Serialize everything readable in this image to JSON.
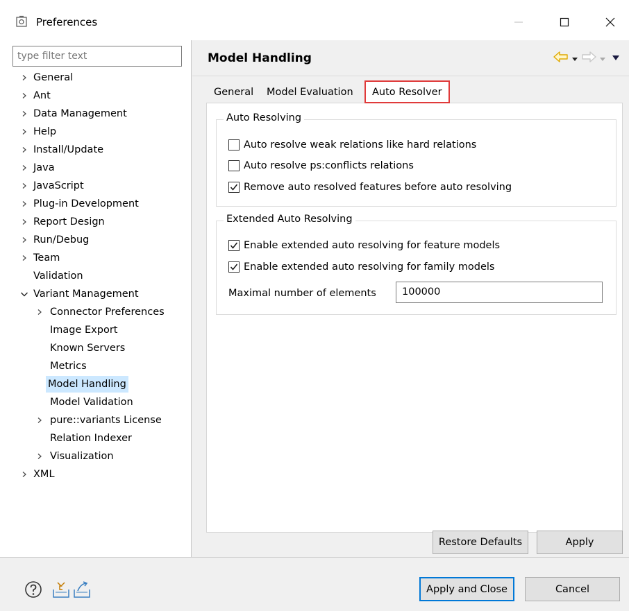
{
  "window": {
    "title": "Preferences",
    "icon": "preferences-icon"
  },
  "filter": {
    "placeholder": "type filter text"
  },
  "tree": [
    {
      "label": "General",
      "expander": "collapsed"
    },
    {
      "label": "Ant",
      "expander": "collapsed"
    },
    {
      "label": "Data Management",
      "expander": "collapsed"
    },
    {
      "label": "Help",
      "expander": "collapsed"
    },
    {
      "label": "Install/Update",
      "expander": "collapsed"
    },
    {
      "label": "Java",
      "expander": "collapsed"
    },
    {
      "label": "JavaScript",
      "expander": "collapsed"
    },
    {
      "label": "Plug-in Development",
      "expander": "collapsed"
    },
    {
      "label": "Report Design",
      "expander": "collapsed"
    },
    {
      "label": "Run/Debug",
      "expander": "collapsed"
    },
    {
      "label": "Team",
      "expander": "collapsed"
    },
    {
      "label": "Validation",
      "expander": "none"
    },
    {
      "label": "Variant Management",
      "expander": "expanded"
    },
    {
      "label": "Connector Preferences",
      "expander": "collapsed"
    },
    {
      "label": "Image Export",
      "expander": "none"
    },
    {
      "label": "Known Servers",
      "expander": "none"
    },
    {
      "label": "Metrics",
      "expander": "none"
    },
    {
      "label": "Model Handling",
      "expander": "none",
      "selected": true
    },
    {
      "label": "Model Validation",
      "expander": "none"
    },
    {
      "label": "pure::variants License",
      "expander": "collapsed"
    },
    {
      "label": "Relation Indexer",
      "expander": "none"
    },
    {
      "label": "Visualization",
      "expander": "collapsed"
    },
    {
      "label": "XML",
      "expander": "collapsed"
    }
  ],
  "page": {
    "title": "Model Handling"
  },
  "tabs": {
    "general": "General",
    "model_evaluation": "Model Evaluation",
    "auto_resolver": "Auto Resolver",
    "active": "Auto Resolver"
  },
  "auto_resolving": {
    "title": "Auto Resolving",
    "options": [
      {
        "label": "Auto resolve weak relations like hard relations",
        "checked": false
      },
      {
        "label": "Auto resolve ps:conflicts relations",
        "checked": false
      },
      {
        "label": "Remove auto resolved features before auto resolving",
        "checked": true
      }
    ]
  },
  "extended_auto_resolving": {
    "title": "Extended Auto Resolving",
    "options": [
      {
        "label": "Enable extended auto resolving for feature models",
        "checked": true
      },
      {
        "label": "Enable extended auto resolving for family models",
        "checked": true
      }
    ],
    "max_elements_label": "Maximal number of elements",
    "max_elements_value": "100000"
  },
  "buttons": {
    "restore_defaults": "Restore Defaults",
    "apply": "Apply",
    "apply_and_close": "Apply and Close",
    "cancel": "Cancel"
  },
  "footer_icons": [
    "help-icon",
    "import-icon",
    "export-icon"
  ],
  "colors": {
    "selection": "#cce8ff",
    "highlight": "#e03a3a",
    "default_button_border": "#0078d7",
    "nav_arrow": "#f2c21b"
  }
}
